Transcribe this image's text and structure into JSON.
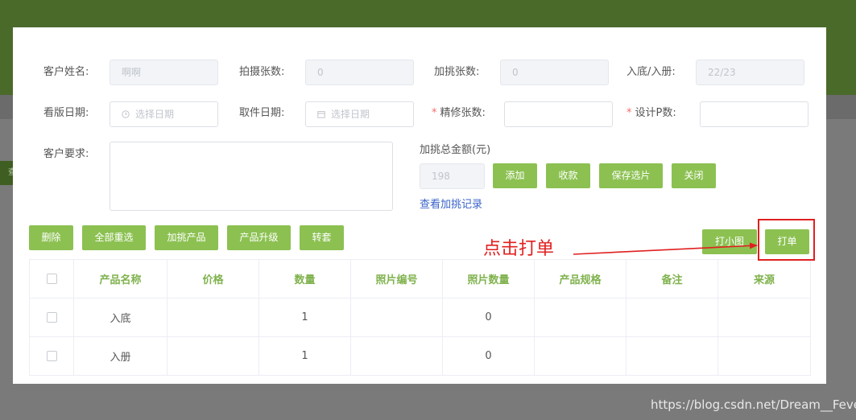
{
  "background": {
    "side_tab_label": "查"
  },
  "form": {
    "customer_name": {
      "label": "客户姓名:",
      "value": "啊啊"
    },
    "shoot_count": {
      "label": "拍摄张数:",
      "value": "0"
    },
    "extra_count": {
      "label": "加挑张数:",
      "value": "0"
    },
    "base_album": {
      "label": "入底/入册:",
      "value": "22/23"
    },
    "review_date": {
      "label": "看版日期:",
      "placeholder": "选择日期"
    },
    "pickup_date": {
      "label": "取件日期:",
      "placeholder": "选择日期"
    },
    "retouch_count": {
      "label": "精修张数:",
      "value": ""
    },
    "design_pages": {
      "label": "设计P数:",
      "value": ""
    },
    "requirements": {
      "label": "客户要求:",
      "value": ""
    },
    "extra_total": {
      "label": "加挑总金额(元)",
      "value": "198"
    }
  },
  "actions": {
    "add": "添加",
    "collect": "收款",
    "save": "保存选片",
    "close": "关闭",
    "view_records": "查看加挑记录"
  },
  "toolbar": {
    "delete": "删除",
    "reselect_all": "全部重选",
    "add_product": "加挑产品",
    "upgrade": "产品升级",
    "transfer": "转套",
    "print_small": "打小图",
    "print_order": "打单"
  },
  "table": {
    "headers": [
      "产品名称",
      "价格",
      "数量",
      "照片编号",
      "照片数量",
      "产品规格",
      "备注",
      "来源"
    ],
    "rows": [
      {
        "name": "入底",
        "price": "",
        "qty": "1",
        "photo_no": "",
        "photo_qty": "0",
        "spec": "",
        "note": "",
        "source": ""
      },
      {
        "name": "入册",
        "price": "",
        "qty": "1",
        "photo_no": "",
        "photo_qty": "0",
        "spec": "",
        "note": "",
        "source": ""
      }
    ]
  },
  "annotation": {
    "text": "点击打单",
    "color": "#e02020"
  },
  "watermark": "https://blog.csdn.net/Dream__Fever",
  "colors": {
    "accent": "#8cc152",
    "header_text": "#7fb24d",
    "link": "#3a63c9",
    "required": "#f56c6c"
  },
  "icons": {
    "date_icon": "clock-icon",
    "date_icon_2": "calendar-icon"
  }
}
